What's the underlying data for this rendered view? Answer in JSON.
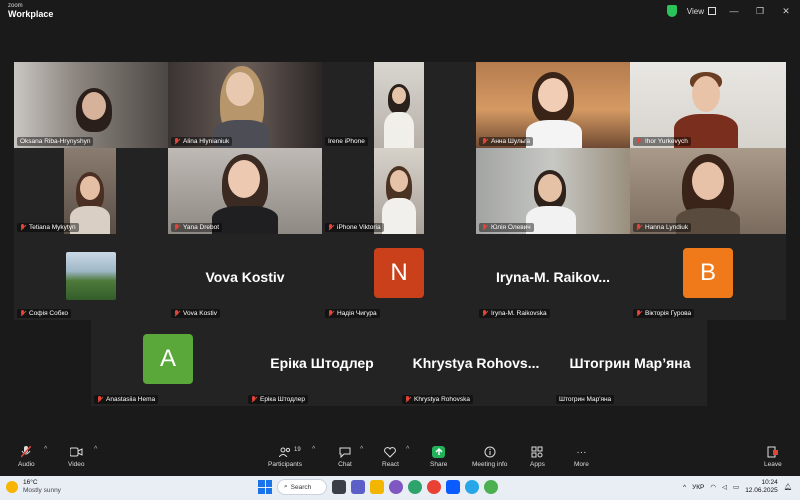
{
  "app": {
    "brand_small": "zoom",
    "brand_big": "Workplace",
    "view_label": "View"
  },
  "tiles": [
    {
      "name": "Oksana Riba-Hrynyshyn",
      "muted": false
    },
    {
      "name": "Alina Hlynianiuk",
      "muted": true
    },
    {
      "name": "Irene iPhone",
      "muted": false
    },
    {
      "name": "Анна Шульга",
      "muted": true
    },
    {
      "name": "Ihor Yurkevych",
      "muted": true
    },
    {
      "name": "Tetiana Mykytyn",
      "muted": true
    },
    {
      "name": "Yana Drebot",
      "muted": true
    },
    {
      "name": "iPhone Viktoria",
      "muted": true
    },
    {
      "name": "Юлія Олевич",
      "muted": true
    },
    {
      "name": "Hanna Lyndiuk",
      "muted": true
    },
    {
      "name": "Софія Собко",
      "muted": true
    },
    {
      "name": "Vova Kostiv",
      "muted": true,
      "big": "Vova Kostiv"
    },
    {
      "name": "Надія Чигура",
      "muted": true,
      "letter": "N"
    },
    {
      "name": "Iryna-M. Raikovska",
      "muted": true,
      "big": "Iryna-M.  Raikov..."
    },
    {
      "name": "Вікторія Гурова",
      "muted": true,
      "letter": "B"
    },
    {
      "name": "Anastasiia Hema",
      "muted": true,
      "letter": "A"
    },
    {
      "name": "Еріка Штодлер",
      "muted": true,
      "big": "Еріка Штодлер"
    },
    {
      "name": "Khrystya Rohovska",
      "muted": true,
      "big": "Khrystya  Rohovs..."
    },
    {
      "name": "Штогрин Мар'яна",
      "muted": false,
      "big": "Штогрин Мар’яна"
    }
  ],
  "avatar_colors": {
    "N": "#c9401a",
    "B": "#f07a1a",
    "A": "#5aa83a"
  },
  "toolbar": {
    "audio": "Audio",
    "video": "Video",
    "participants": "Participants",
    "participants_count": "19",
    "chat": "Chat",
    "react": "React",
    "share": "Share",
    "meeting_info": "Meeting info",
    "apps": "Apps",
    "more": "More",
    "leave": "Leave"
  },
  "taskbar": {
    "temp": "16°C",
    "weather": "Mostly sunny",
    "search": "Search",
    "lang": "УКР",
    "time": "10:24",
    "date": "12.06.2025"
  }
}
